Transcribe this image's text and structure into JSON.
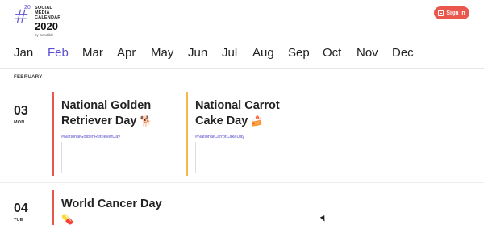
{
  "header": {
    "logo_hash": "#",
    "logo_sup": "20",
    "logo_line1": "SOCIAL",
    "logo_line2": "MEDIA",
    "logo_line3": "CALENDAR",
    "logo_year": "2020",
    "logo_by": "by Sendible",
    "signin_label": "Sign in"
  },
  "months": [
    {
      "label": "Jan",
      "active": false
    },
    {
      "label": "Feb",
      "active": true
    },
    {
      "label": "Mar",
      "active": false
    },
    {
      "label": "Apr",
      "active": false
    },
    {
      "label": "May",
      "active": false
    },
    {
      "label": "Jun",
      "active": false
    },
    {
      "label": "Jul",
      "active": false
    },
    {
      "label": "Aug",
      "active": false
    },
    {
      "label": "Sep",
      "active": false
    },
    {
      "label": "Oct",
      "active": false
    },
    {
      "label": "Nov",
      "active": false
    },
    {
      "label": "Dec",
      "active": false
    }
  ],
  "section_label": "FEBRUARY",
  "days": [
    {
      "num": "03",
      "dow": "MON",
      "events": [
        {
          "title_line1": "National Golden",
          "title_line2": "Retriever Day",
          "emoji": "🐕",
          "hashtag": "#NationalGoldenRetrieverDay",
          "color": "#e9574d"
        },
        {
          "title_line1": "National Carrot",
          "title_line2": "Cake Day",
          "emoji": "🍰",
          "hashtag": "#NationalCarrotCakeDay",
          "color": "#f5b84a"
        }
      ]
    },
    {
      "num": "04",
      "dow": "TUE",
      "events": [
        {
          "title_line1": "World Cancer Day",
          "title_line2": "",
          "emoji": "💊",
          "hashtag": "",
          "color": "#e9574d"
        }
      ]
    }
  ],
  "colors": {
    "accent": "#5a4fcf",
    "signin": "#e9574d"
  }
}
